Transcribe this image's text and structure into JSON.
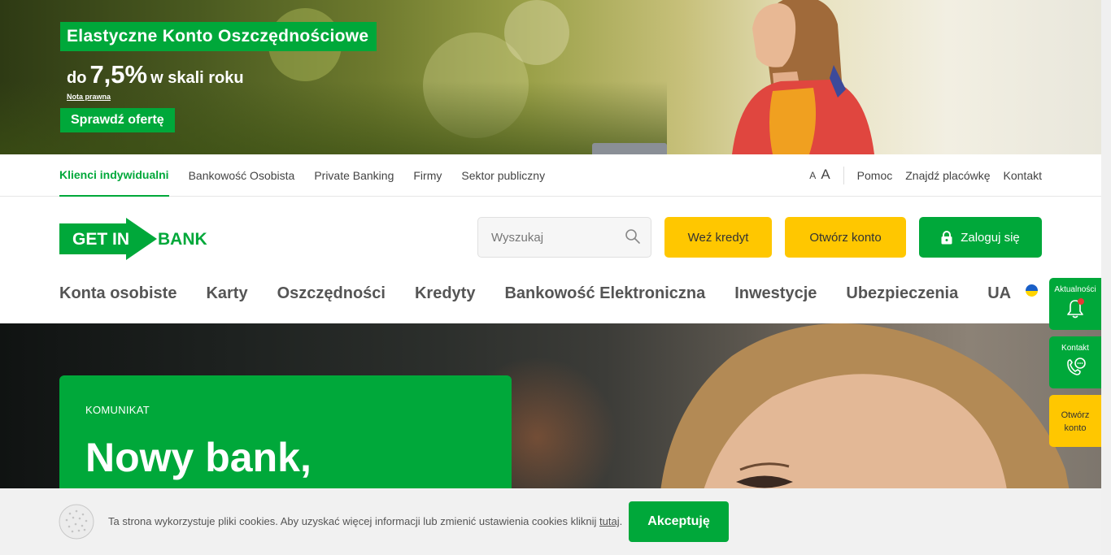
{
  "promo": {
    "title": "Elastyczne Konto Oszczędnościowe",
    "rate_prefix": "do",
    "rate_value": "7,5%",
    "rate_suffix": "w skali roku",
    "legal_note": "Nota prawna",
    "cta_label": "Sprawdź ofertę"
  },
  "subnav": {
    "items": [
      {
        "label": "Klienci indywidualni",
        "active": true
      },
      {
        "label": "Bankowość Osobista"
      },
      {
        "label": "Private Banking"
      },
      {
        "label": "Firmy"
      },
      {
        "label": "Sektor publiczny"
      }
    ],
    "font_small": "A",
    "font_large": "A",
    "links": [
      "Pomoc",
      "Znajdź placówkę",
      "Kontakt"
    ]
  },
  "header": {
    "logo_text_left": "GET IN",
    "logo_text_right": "BANK",
    "search_placeholder": "Wyszukaj",
    "credit_label": "Weź kredyt",
    "account_label": "Otwórz konto",
    "login_label": "Zaloguj się"
  },
  "mainnav": {
    "items": [
      "Konta osobiste",
      "Karty",
      "Oszczędności",
      "Kredyty",
      "Bankowość Elektroniczna",
      "Inwestycje",
      "Ubezpieczenia",
      "UA"
    ]
  },
  "hero": {
    "label": "KOMUNIKAT",
    "title": "Nowy bank,"
  },
  "widgets": {
    "news_label": "Aktualności",
    "contact_label": "Kontakt",
    "open_label_1": "Otwórz",
    "open_label_2": "konto"
  },
  "cookies": {
    "text": "Ta strona wykorzystuje pliki cookies. Aby uzyskać więcej informacji lub zmienić ustawienia cookies kliknij",
    "link": "tutaj",
    "after": ".",
    "accept_label": "Akceptuję"
  },
  "colors": {
    "brand_green": "#00a83a",
    "accent_yellow": "#ffc700"
  }
}
